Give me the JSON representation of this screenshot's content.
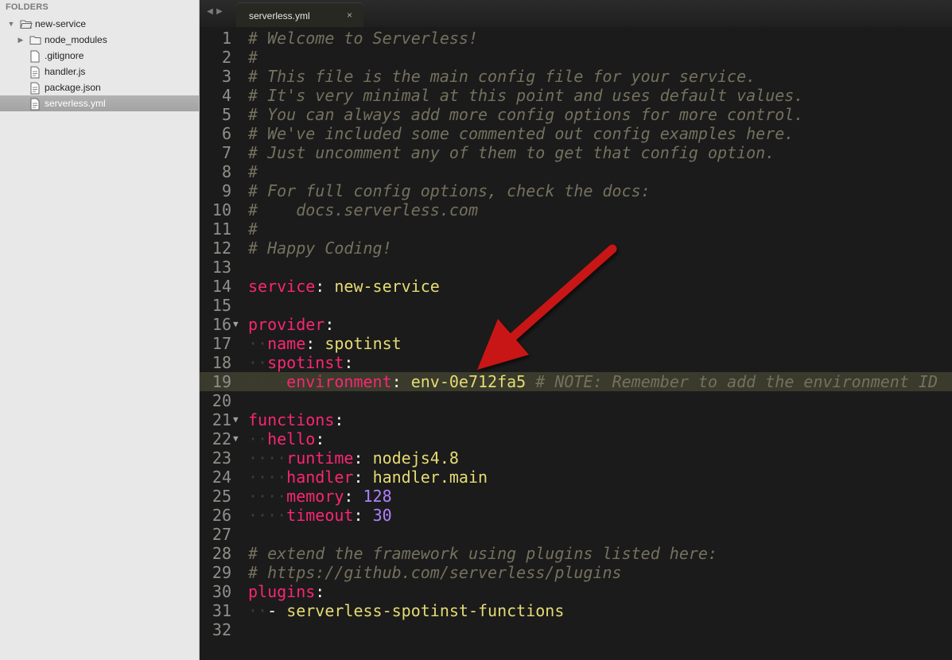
{
  "sidebar": {
    "header": "FOLDERS",
    "items": [
      {
        "label": "new-service",
        "icon": "folder-open-icon",
        "twisty": "▼"
      },
      {
        "label": "node_modules",
        "icon": "folder-icon",
        "twisty": "▶"
      },
      {
        "label": ".gitignore",
        "icon": "file-icon"
      },
      {
        "label": "handler.js",
        "icon": "file-icon"
      },
      {
        "label": "package.json",
        "icon": "file-icon"
      },
      {
        "label": "serverless.yml",
        "icon": "file-icon",
        "selected": true
      }
    ]
  },
  "tabbar": {
    "nav_back": "◀",
    "nav_forward": "▶",
    "tab": {
      "label": "serverless.yml",
      "close": "×"
    }
  },
  "editor": {
    "highlighted_line": 19,
    "lines": [
      {
        "n": "1",
        "parts": [
          {
            "t": "# Welcome to Serverless!",
            "c": "c"
          }
        ]
      },
      {
        "n": "2",
        "parts": [
          {
            "t": "#",
            "c": "c"
          }
        ]
      },
      {
        "n": "3",
        "parts": [
          {
            "t": "# This file is the main config file for your service.",
            "c": "c"
          }
        ]
      },
      {
        "n": "4",
        "parts": [
          {
            "t": "# It's very minimal at this point and uses default values.",
            "c": "c"
          }
        ]
      },
      {
        "n": "5",
        "parts": [
          {
            "t": "# You can always add more config options for more control.",
            "c": "c"
          }
        ]
      },
      {
        "n": "6",
        "parts": [
          {
            "t": "# We've included some commented out config examples here.",
            "c": "c"
          }
        ]
      },
      {
        "n": "7",
        "parts": [
          {
            "t": "# Just uncomment any of them to get that config option.",
            "c": "c"
          }
        ]
      },
      {
        "n": "8",
        "parts": [
          {
            "t": "#",
            "c": "c"
          }
        ]
      },
      {
        "n": "9",
        "parts": [
          {
            "t": "# For full config options, check the docs:",
            "c": "c"
          }
        ]
      },
      {
        "n": "10",
        "parts": [
          {
            "t": "#    docs.serverless.com",
            "c": "c"
          }
        ]
      },
      {
        "n": "11",
        "parts": [
          {
            "t": "#",
            "c": "c"
          }
        ]
      },
      {
        "n": "12",
        "parts": [
          {
            "t": "# Happy Coding!",
            "c": "c"
          }
        ]
      },
      {
        "n": "13",
        "parts": []
      },
      {
        "n": "14",
        "parts": [
          {
            "t": "service",
            "c": "k"
          },
          {
            "t": ": ",
            "c": "p"
          },
          {
            "t": "new-service",
            "c": "s"
          }
        ]
      },
      {
        "n": "15",
        "parts": []
      },
      {
        "n": "16",
        "fold": "▼",
        "parts": [
          {
            "t": "provider",
            "c": "k"
          },
          {
            "t": ":",
            "c": "p"
          }
        ]
      },
      {
        "n": "17",
        "parts": [
          {
            "t": "··",
            "c": "g"
          },
          {
            "t": "name",
            "c": "k"
          },
          {
            "t": ": ",
            "c": "p"
          },
          {
            "t": "spotinst",
            "c": "s"
          }
        ]
      },
      {
        "n": "18",
        "parts": [
          {
            "t": "··",
            "c": "g"
          },
          {
            "t": "spotinst",
            "c": "k"
          },
          {
            "t": ":",
            "c": "p"
          }
        ]
      },
      {
        "n": "19",
        "parts": [
          {
            "t": "····",
            "c": "g"
          },
          {
            "t": "environment",
            "c": "k"
          },
          {
            "t": ": ",
            "c": "p"
          },
          {
            "t": "env-0e712fa5",
            "c": "s"
          },
          {
            "t": " # NOTE: Remember to add the environment ID",
            "c": "c"
          }
        ]
      },
      {
        "n": "20",
        "parts": []
      },
      {
        "n": "21",
        "fold": "▼",
        "parts": [
          {
            "t": "functions",
            "c": "k"
          },
          {
            "t": ":",
            "c": "p"
          }
        ]
      },
      {
        "n": "22",
        "fold": "▼",
        "parts": [
          {
            "t": "··",
            "c": "g"
          },
          {
            "t": "hello",
            "c": "k"
          },
          {
            "t": ":",
            "c": "p"
          }
        ]
      },
      {
        "n": "23",
        "parts": [
          {
            "t": "····",
            "c": "g"
          },
          {
            "t": "runtime",
            "c": "k"
          },
          {
            "t": ": ",
            "c": "p"
          },
          {
            "t": "nodejs4.8",
            "c": "s"
          }
        ]
      },
      {
        "n": "24",
        "parts": [
          {
            "t": "····",
            "c": "g"
          },
          {
            "t": "handler",
            "c": "k"
          },
          {
            "t": ": ",
            "c": "p"
          },
          {
            "t": "handler.main",
            "c": "s"
          }
        ]
      },
      {
        "n": "25",
        "parts": [
          {
            "t": "····",
            "c": "g"
          },
          {
            "t": "memory",
            "c": "k"
          },
          {
            "t": ": ",
            "c": "p"
          },
          {
            "t": "128",
            "c": "n"
          }
        ]
      },
      {
        "n": "26",
        "parts": [
          {
            "t": "····",
            "c": "g"
          },
          {
            "t": "timeout",
            "c": "k"
          },
          {
            "t": ": ",
            "c": "p"
          },
          {
            "t": "30",
            "c": "n"
          }
        ]
      },
      {
        "n": "27",
        "parts": []
      },
      {
        "n": "28",
        "parts": [
          {
            "t": "# extend the framework using plugins listed here:",
            "c": "c"
          }
        ]
      },
      {
        "n": "29",
        "parts": [
          {
            "t": "# https://github.com/serverless/plugins",
            "c": "c"
          }
        ]
      },
      {
        "n": "30",
        "parts": [
          {
            "t": "plugins",
            "c": "k"
          },
          {
            "t": ":",
            "c": "p"
          }
        ]
      },
      {
        "n": "31",
        "parts": [
          {
            "t": "··",
            "c": "g"
          },
          {
            "t": "- ",
            "c": "p"
          },
          {
            "t": "serverless-spotinst-functions",
            "c": "s"
          }
        ]
      },
      {
        "n": "32",
        "parts": []
      }
    ]
  },
  "colors": {
    "comment": "#75715e",
    "key": "#f92672",
    "string": "#e6db74",
    "number": "#ae81ff",
    "annotation_arrow": "#c81414"
  }
}
